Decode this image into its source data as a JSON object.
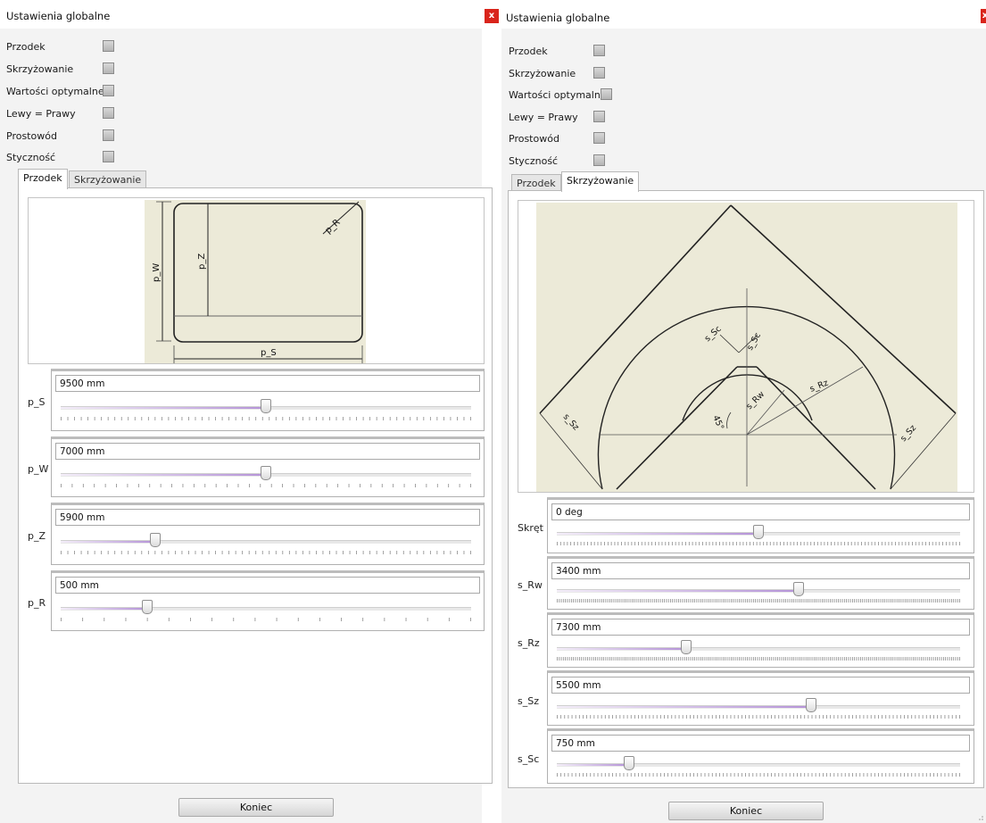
{
  "window_left": {
    "title": "Ustawienia globalne",
    "close_glyph": "x",
    "checkboxes": [
      {
        "label": "Przodek",
        "checked": false
      },
      {
        "label": "Skrzyżowanie",
        "checked": false
      },
      {
        "label": "Wartości optymalne",
        "checked": false
      },
      {
        "label": "Lewy = Prawy",
        "checked": false
      },
      {
        "label": "Prostowód",
        "checked": false
      },
      {
        "label": "Styczność",
        "checked": false
      }
    ],
    "tabs": [
      {
        "label": "Przodek",
        "active": true
      },
      {
        "label": "Skrzyżowanie",
        "active": false
      }
    ],
    "diagram": {
      "labels": {
        "width": "p_W",
        "inner": "p_Z",
        "radius": "p_R",
        "span": "p_S"
      }
    },
    "sliders": [
      {
        "label": "p_S",
        "value_text": "9500 mm",
        "fraction": 0.5
      },
      {
        "label": "p_W",
        "value_text": "7000 mm",
        "fraction": 0.5
      },
      {
        "label": "p_Z",
        "value_text": "5900 mm",
        "fraction": 0.23
      },
      {
        "label": "p_R",
        "value_text": "500 mm",
        "fraction": 0.21
      }
    ],
    "button_label": "Koniec"
  },
  "window_right": {
    "title": "Ustawienia globalne",
    "close_glyph": "x",
    "checkboxes": [
      {
        "label": "Przodek",
        "checked": false
      },
      {
        "label": "Skrzyżowanie",
        "checked": false
      },
      {
        "label": "Wartości optymalne",
        "checked": false
      },
      {
        "label": "Lewy = Prawy",
        "checked": false
      },
      {
        "label": "Prostowód",
        "checked": false
      },
      {
        "label": "Styczność",
        "checked": false
      }
    ],
    "tabs": [
      {
        "label": "Przodek",
        "active": false
      },
      {
        "label": "Skrzyżowanie",
        "active": true
      }
    ],
    "diagram": {
      "labels": {
        "sc": "s_Sc",
        "sc2": "s_Sc",
        "rw": "s_Rw",
        "rz": "s_Rz",
        "sz_left": "s_Sz",
        "sz_right": "s_Sz",
        "angle": "45°"
      }
    },
    "sliders": [
      {
        "label": "Skręt",
        "value_text": "0 deg",
        "fraction": 0.5
      },
      {
        "label": "s_Rw",
        "value_text": "3400 mm",
        "fraction": 0.6
      },
      {
        "label": "s_Rz",
        "value_text": "7300 mm",
        "fraction": 0.32
      },
      {
        "label": "s_Sz",
        "value_text": "5500 mm",
        "fraction": 0.63
      },
      {
        "label": "s_Sc",
        "value_text": "750 mm",
        "fraction": 0.18
      }
    ],
    "button_label": "Koniec"
  },
  "colors": {
    "close_button": "#d9241b",
    "diagram_background": "#ecead8",
    "slider_fill": "#b593d8"
  }
}
